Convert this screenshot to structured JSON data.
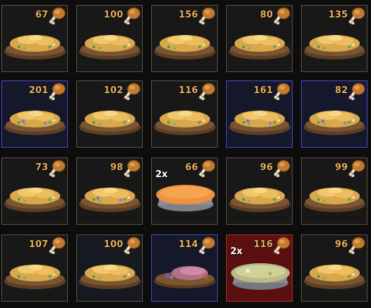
{
  "inventory": {
    "items": [
      {
        "count": "67",
        "mult": "",
        "food": "omelet",
        "bg": "normal"
      },
      {
        "count": "100",
        "mult": "",
        "food": "omelet",
        "bg": "normal"
      },
      {
        "count": "156",
        "mult": "",
        "food": "omelet",
        "bg": "normal"
      },
      {
        "count": "80",
        "mult": "",
        "food": "omelet",
        "bg": "normal"
      },
      {
        "count": "135",
        "mult": "",
        "food": "omelet",
        "bg": "normal"
      },
      {
        "count": "201",
        "mult": "",
        "food": "omelet-purple",
        "bg": "blue"
      },
      {
        "count": "102",
        "mult": "",
        "food": "omelet",
        "bg": "normal"
      },
      {
        "count": "116",
        "mult": "",
        "food": "omelet",
        "bg": "normal"
      },
      {
        "count": "161",
        "mult": "",
        "food": "omelet-purple",
        "bg": "blue"
      },
      {
        "count": "82",
        "mult": "",
        "food": "omelet-purple",
        "bg": "blue-spark"
      },
      {
        "count": "73",
        "mult": "",
        "food": "omelet",
        "bg": "normal"
      },
      {
        "count": "98",
        "mult": "",
        "food": "omelet-purple",
        "bg": "normal"
      },
      {
        "count": "66",
        "mult": "2x",
        "food": "pie",
        "bg": "normal"
      },
      {
        "count": "96",
        "mult": "",
        "food": "omelet",
        "bg": "normal"
      },
      {
        "count": "99",
        "mult": "",
        "food": "omelet",
        "bg": "normal"
      },
      {
        "count": "107",
        "mult": "",
        "food": "omelet",
        "bg": "normal"
      },
      {
        "count": "100",
        "mult": "",
        "food": "omelet",
        "bg": "spark"
      },
      {
        "count": "114",
        "mult": "",
        "food": "meat",
        "bg": "blue"
      },
      {
        "count": "116",
        "mult": "2x",
        "food": "green-pie",
        "bg": "red"
      },
      {
        "count": "96",
        "mult": "",
        "food": "omelet",
        "bg": "normal"
      }
    ]
  },
  "colors": {
    "count_text": "#e8b060",
    "rarity_blue": "#4c4ccc",
    "rarity_red": "#b03030",
    "slot_border": "#5a5440"
  }
}
